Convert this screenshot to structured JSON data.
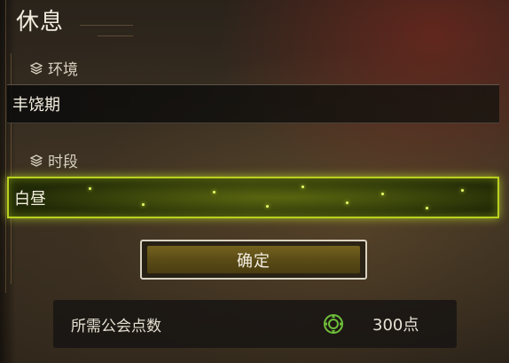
{
  "screen": {
    "title": "休息"
  },
  "environment": {
    "header": "环境",
    "icon": "layers-icon",
    "value": "丰饶期"
  },
  "time_of_day": {
    "header": "时段",
    "icon": "layers-icon",
    "value": "白昼",
    "highlight_color": "#b9d11f"
  },
  "confirm": {
    "label": "确定"
  },
  "cost": {
    "label": "所需公会点数",
    "icon": "guild-points-icon",
    "value": "300点",
    "icon_color": "#6fbf3a"
  }
}
